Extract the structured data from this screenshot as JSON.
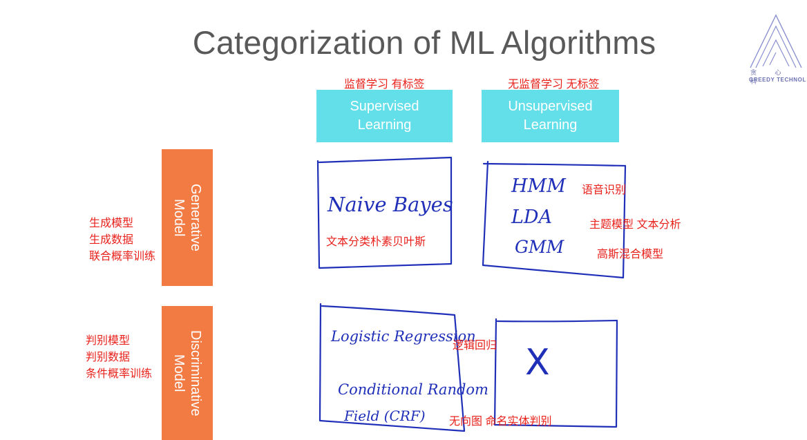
{
  "slide": {
    "title": "Categorization of ML Algorithms",
    "logo": {
      "cn": "贪 心 科",
      "en": "GREEDY TECHNOL"
    }
  },
  "columns": [
    {
      "label_line1": "Supervised",
      "label_line2": "Learning",
      "annotation": "监督学习 有标签"
    },
    {
      "label_line1": "Unsupervised",
      "label_line2": "Learning",
      "annotation": "无监督学习 无标签"
    }
  ],
  "rows": [
    {
      "label_line1": "Generative",
      "label_line2": "Model",
      "annotations": [
        "生成模型",
        "生成数据",
        "联合概率训练"
      ]
    },
    {
      "label_line1": "Discriminative",
      "label_line2": "Model",
      "annotations": [
        "判别模型",
        "判别数据",
        "条件概率训练"
      ]
    }
  ],
  "cells": {
    "generative_supervised": {
      "handwriting": "Naive Bayes",
      "annotation": "文本分类朴素贝叶斯"
    },
    "generative_unsupervised": {
      "items": [
        {
          "handwriting": "HMM",
          "annotation": "语音识别"
        },
        {
          "handwriting": "LDA",
          "annotation": "主题模型 文本分析"
        },
        {
          "handwriting": "GMM",
          "annotation": "高斯混合模型"
        }
      ]
    },
    "discriminative_supervised": {
      "items": [
        {
          "handwriting": "Logistic Regression",
          "annotation": "逻辑回归"
        },
        {
          "handwriting_line1": "Conditional Random",
          "handwriting_line2": "Field (CRF)",
          "annotation": "无向图 命名实体判别"
        }
      ]
    },
    "discriminative_unsupervised": {
      "handwriting": "X"
    }
  },
  "colors": {
    "cyan": "#62dfe8",
    "orange": "#f27a43",
    "ink": "#1f2fb8",
    "annotation": "#e8211b",
    "title": "#595959"
  }
}
